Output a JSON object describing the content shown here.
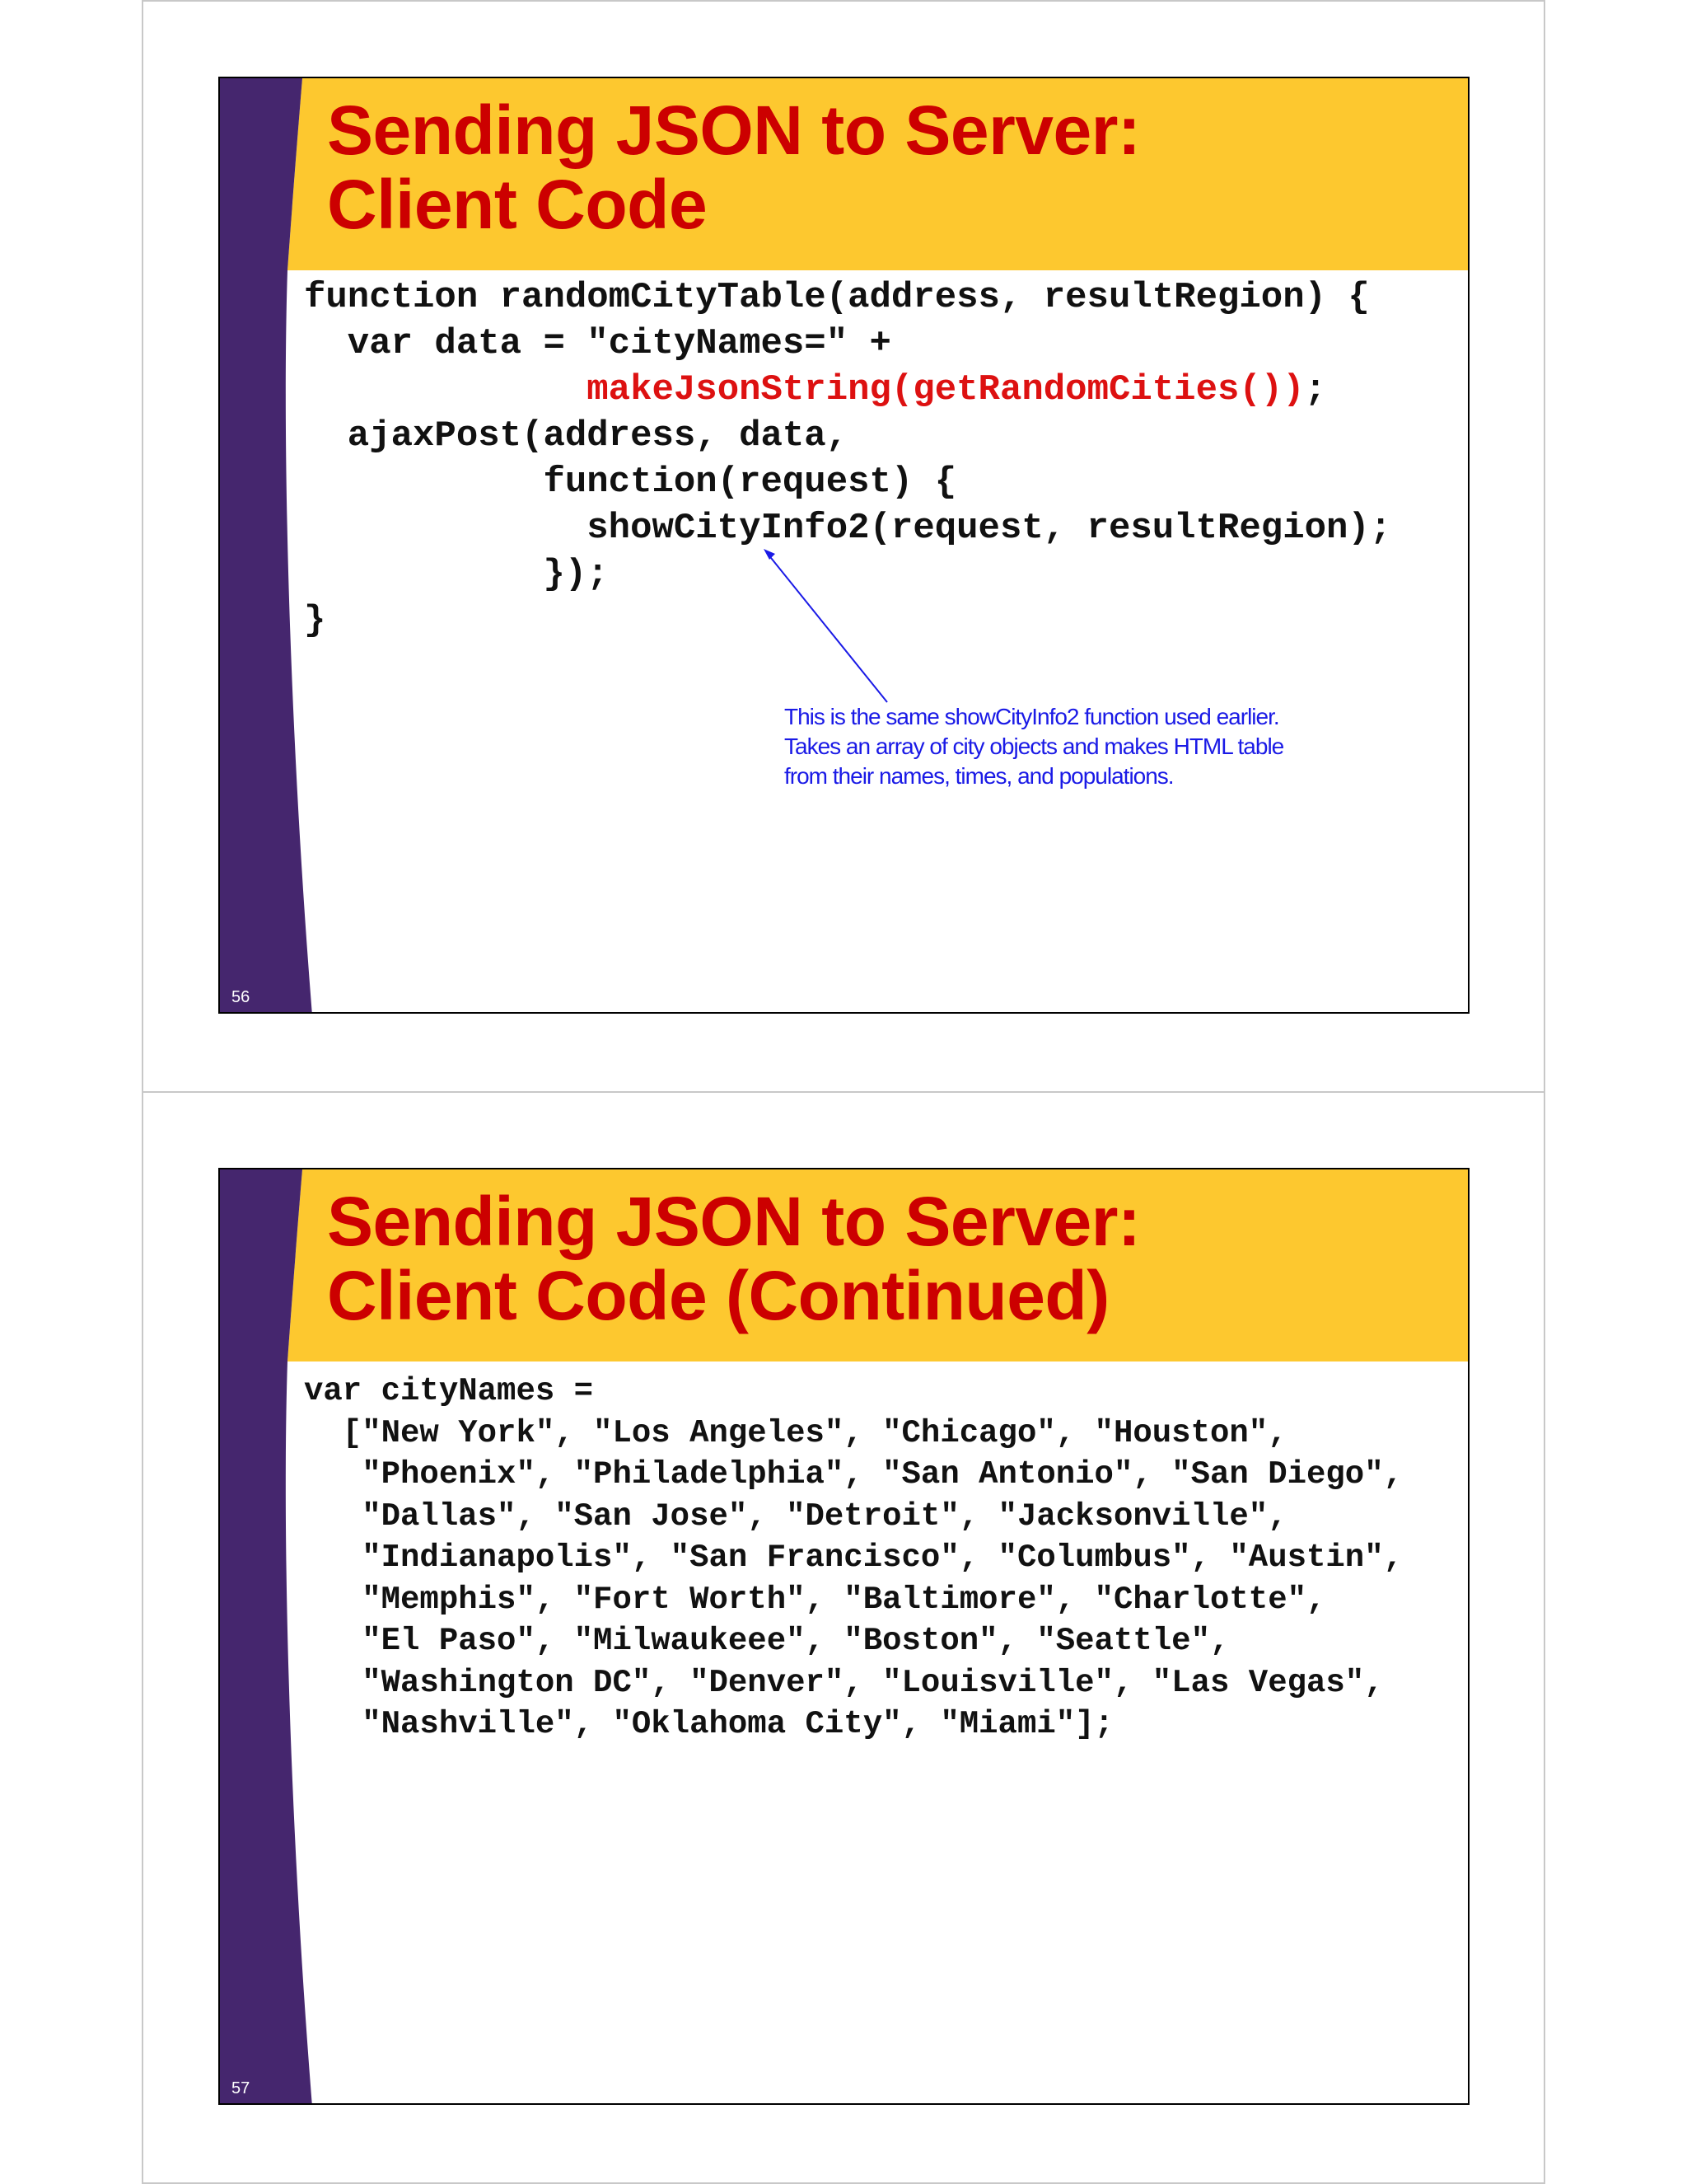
{
  "slides": [
    {
      "title_lines": [
        "Sending JSON to Server:",
        "Client Code"
      ],
      "code_lines": [
        [
          {
            "t": "function randomCityTable(address, resultRegion) {"
          }
        ],
        [
          {
            "t": "  var data = \"cityNames=\" +"
          }
        ],
        [
          {
            "t": "             "
          },
          {
            "t": "makeJsonString(getRandomCities())",
            "hl": true
          },
          {
            "t": ";"
          }
        ],
        [
          {
            "t": "  ajaxPost(address, data,"
          }
        ],
        [
          {
            "t": "           function(request) {"
          }
        ],
        [
          {
            "t": "             showCityInfo2(request, resultRegion);"
          }
        ],
        [
          {
            "t": "           });"
          }
        ],
        [
          {
            "t": "}"
          }
        ]
      ],
      "callout_lines": [
        "This is the same showCityInfo2 function used earlier.",
        "Takes an array of city objects and makes HTML table",
        "from their names, times, and populations."
      ],
      "page_number": "56"
    },
    {
      "title_lines": [
        "Sending JSON to Server:",
        "Client Code (Continued)"
      ],
      "code_lines": [
        [
          {
            "t": "var cityNames ="
          }
        ],
        [
          {
            "t": "  [\"New York\", \"Los Angeles\", \"Chicago\", \"Houston\","
          }
        ],
        [
          {
            "t": "   \"Phoenix\", \"Philadelphia\", \"San Antonio\", \"San Diego\","
          }
        ],
        [
          {
            "t": "   \"Dallas\", \"San Jose\", \"Detroit\", \"Jacksonville\","
          }
        ],
        [
          {
            "t": "   \"Indianapolis\", \"San Francisco\", \"Columbus\", \"Austin\","
          }
        ],
        [
          {
            "t": "   \"Memphis\", \"Fort Worth\", \"Baltimore\", \"Charlotte\","
          }
        ],
        [
          {
            "t": "   \"El Paso\", \"Milwaukeee\", \"Boston\", \"Seattle\","
          }
        ],
        [
          {
            "t": "   \"Washington DC\", \"Denver\", \"Louisville\", \"Las Vegas\","
          }
        ],
        [
          {
            "t": "   \"Nashville\", \"Oklahoma City\", \"Miami\"];"
          }
        ]
      ],
      "page_number": "57"
    }
  ],
  "colors": {
    "title_red": "#cc0000",
    "banner_gold": "#fdc82f",
    "sidebar_purple": "#45266e",
    "code_highlight_red": "#dd1111",
    "callout_blue": "#1a1ae6"
  }
}
